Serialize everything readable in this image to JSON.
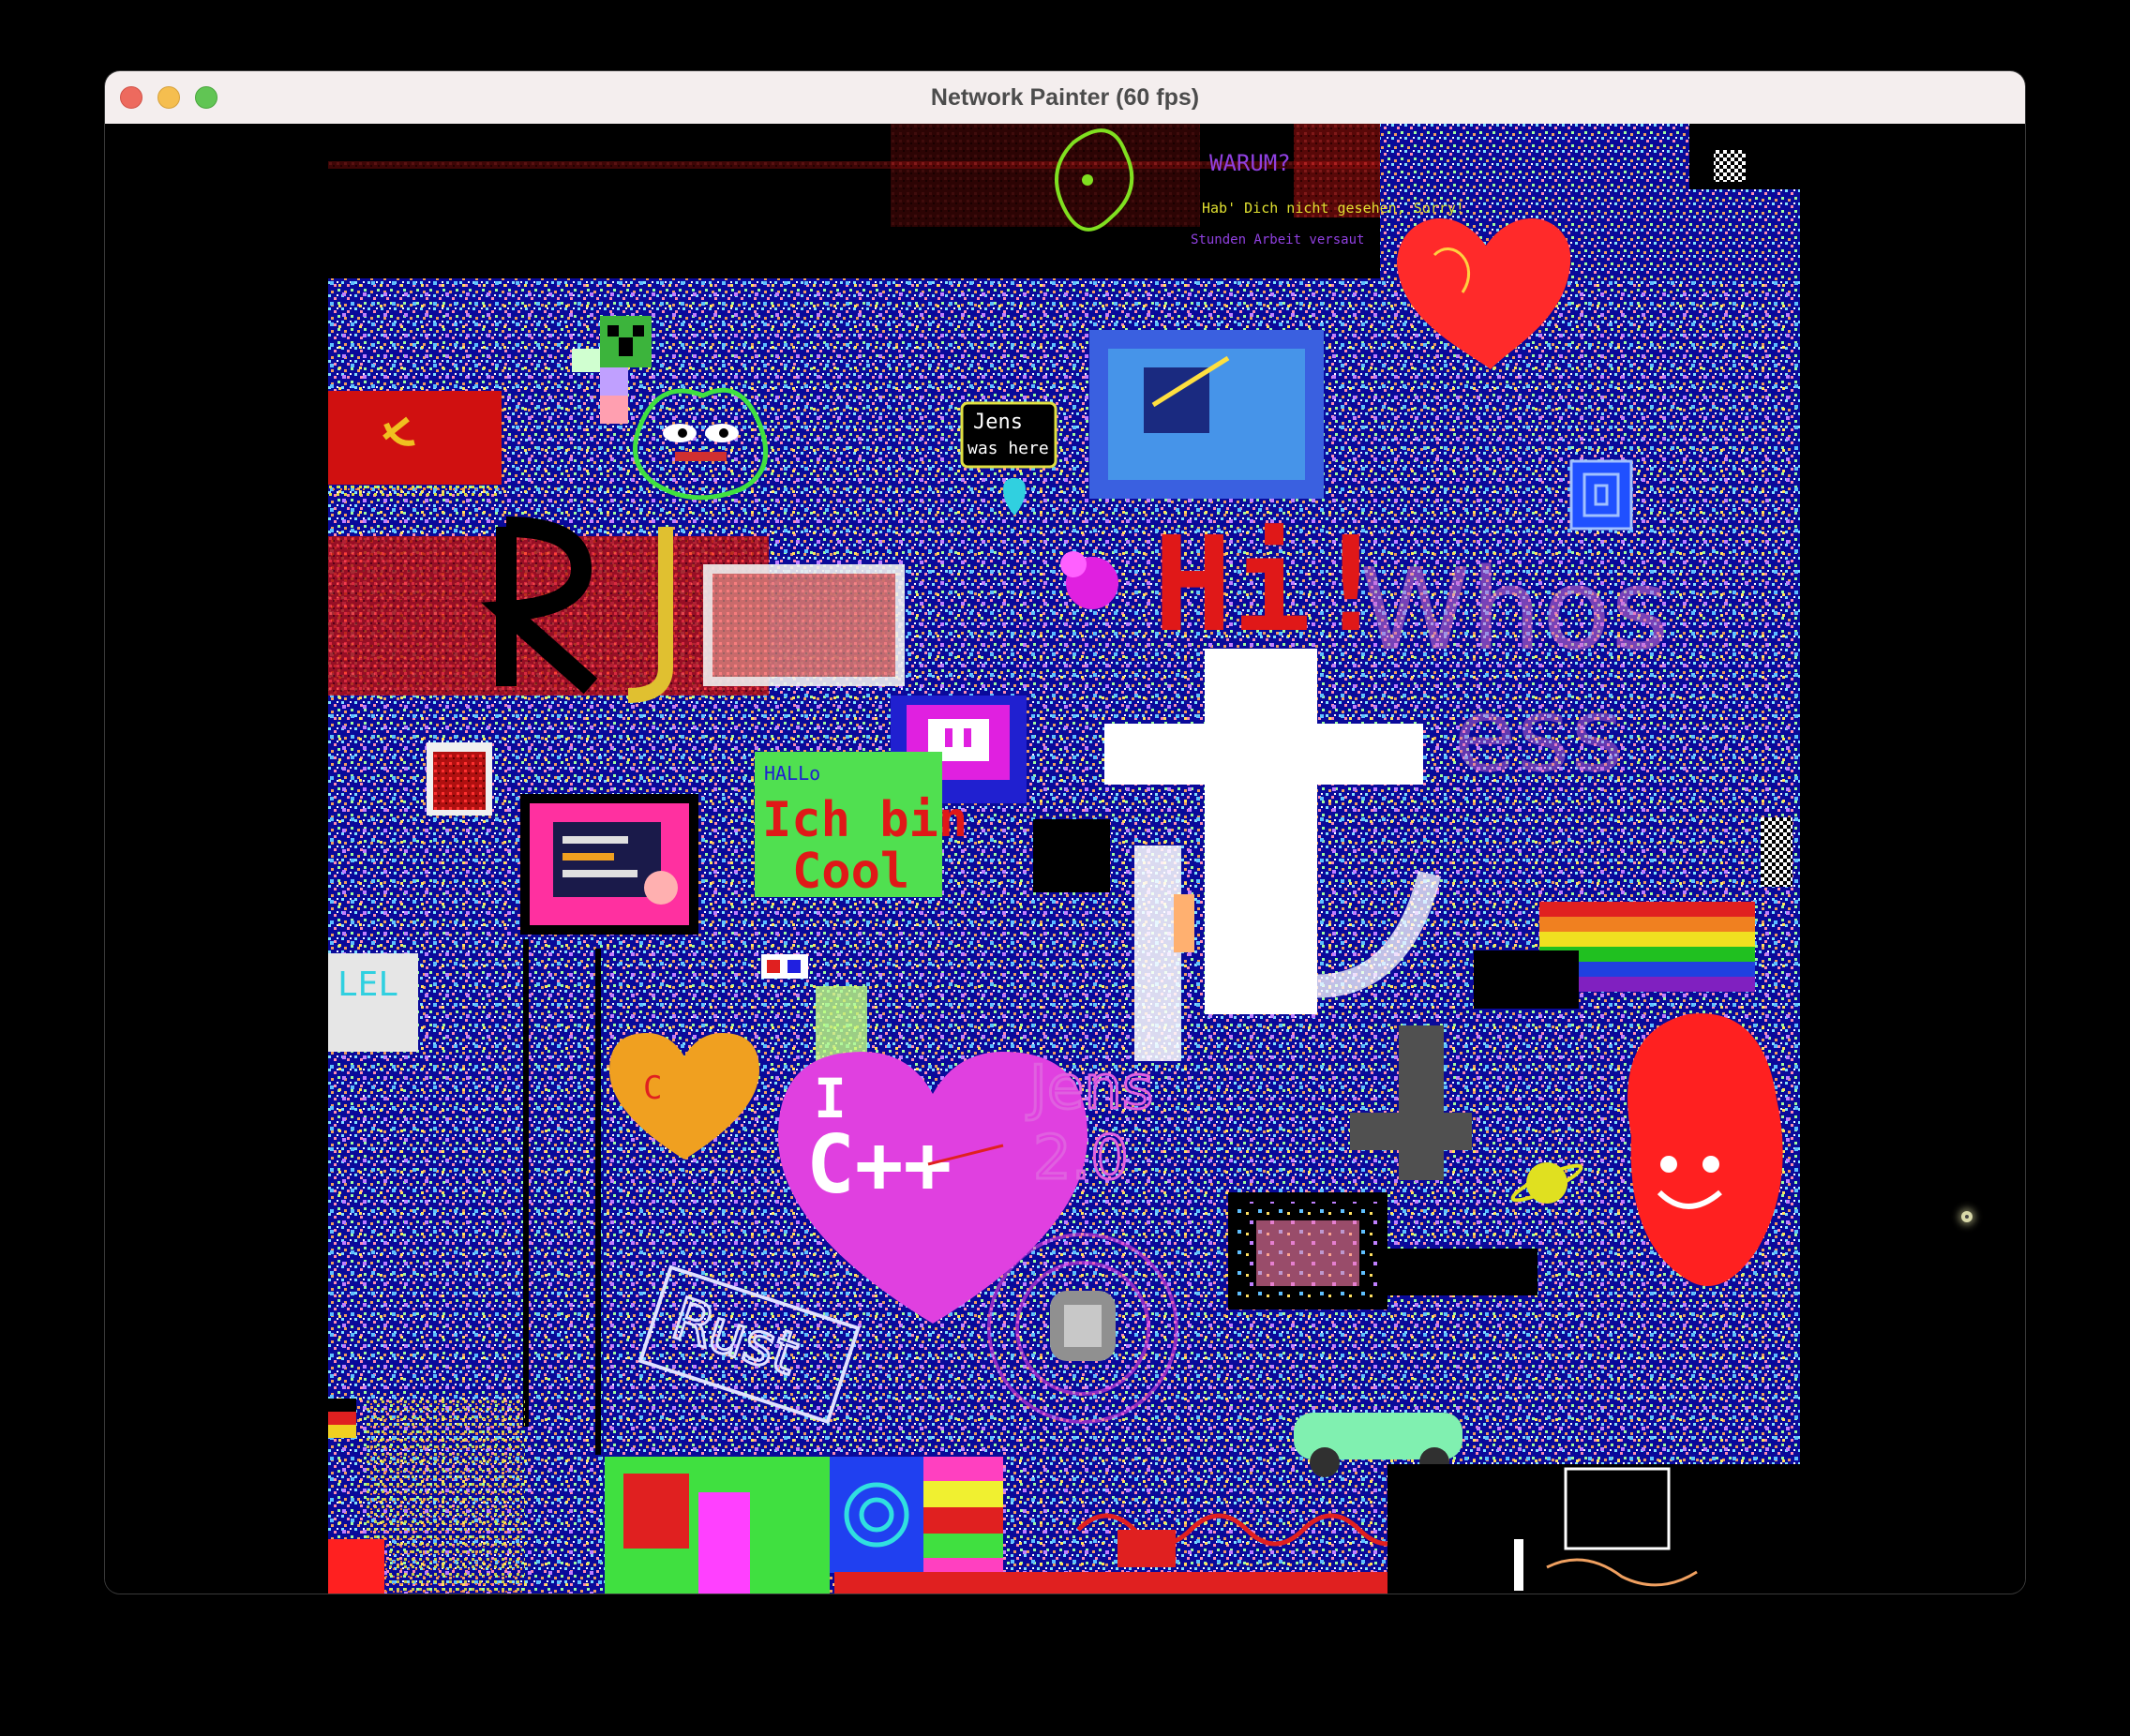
{
  "window": {
    "title": "Network Painter (60 fps)"
  },
  "colors": {
    "canvas_bg": "#0a0a9a",
    "titlebar_bg": "#f4eeee",
    "close": "#ed6a5e",
    "minimize": "#f5be4f",
    "maximize": "#61c554"
  },
  "canvas": {
    "texts": [
      {
        "text": "Hi!",
        "color": "#e01818"
      },
      {
        "text": "Ich bin",
        "color": "#e01818"
      },
      {
        "text": "Cool",
        "color": "#e01818"
      },
      {
        "text": "HALLo",
        "color": "#2020d0"
      },
      {
        "text": "Jens",
        "color": "#ffffff"
      },
      {
        "text": "was here",
        "color": "#ffffff"
      },
      {
        "text": "LEL",
        "color": "#30d0e0"
      },
      {
        "text": "I",
        "color": "#ffffff"
      },
      {
        "text": "C++",
        "color": "#ffffff"
      },
      {
        "text": "Jens",
        "color": "#e060e0"
      },
      {
        "text": "2.0",
        "color": "#e060e0"
      },
      {
        "text": "Rust",
        "color": "#e0e0ff"
      },
      {
        "text": "WARUM?",
        "color": "#9040e0"
      },
      {
        "text": "Hab' Dich nicht gesehen, Sorry!",
        "color": "#e0e030"
      },
      {
        "text": "Stunden Arbeit versaut",
        "color": "#9040e0"
      },
      {
        "text": "C",
        "color": "#e02020"
      }
    ]
  }
}
